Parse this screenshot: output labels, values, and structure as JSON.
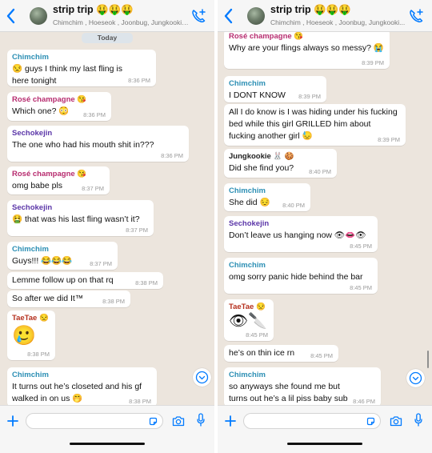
{
  "left": {
    "header": {
      "title": "strip trip 🤑🤑🤑",
      "subtitle": "Chimchim , Hoeseok , Joonbug, Jungkookie..."
    },
    "date_label": "Today",
    "messages": [
      {
        "sender": "Chimchim",
        "text": "😒 guys I think my last fling is here tonight",
        "time": "8:36 PM"
      },
      {
        "sender": "Rosé champagne 😘",
        "text": "Which one? 😳",
        "time": "8:36 PM"
      },
      {
        "sender": "Sechokejin",
        "text": "The one who had his mouth shit in???",
        "time": "8:36 PM"
      },
      {
        "sender": "Rosé champagne 😘",
        "text": "omg babe pls",
        "time": "8:37 PM"
      },
      {
        "sender": "Sechokejin",
        "text": "🤮 that was his last fling wasn’t it?",
        "time": "8:37 PM"
      },
      {
        "sender": "Chimchim",
        "text": "Guys!!! 😂😂😂",
        "time": "8:37 PM"
      },
      {
        "text": "Lemme follow up on that rq",
        "time": "8:38 PM"
      },
      {
        "text": "So after we did It™",
        "time": "8:38 PM"
      },
      {
        "sender": "TaeTae 😒",
        "text": "🥲",
        "time": "8:38 PM"
      },
      {
        "sender": "Chimchim",
        "text": "It turns out he’s closeted and his gf walked in on us 🤭",
        "time": "8:38 PM"
      }
    ]
  },
  "right": {
    "header": {
      "title": "strip trip 🤑🤑🤑",
      "subtitle": "Chimchim , Hoeseok , Joonbug, Jungkooki..."
    },
    "messages": [
      {
        "sender": "Rosé champagne 😘",
        "text": "Why are your flings always so messy? 😭",
        "time": "8:39 PM"
      },
      {
        "sender": "Chimchim",
        "text": "I DONT KNOW",
        "time": "8:39 PM"
      },
      {
        "text": "All I do know is I was hiding under his fucking bed while this girl GRILLED him about fucking another girl 😓",
        "time": "8:39 PM"
      },
      {
        "sender": "Jungkookie 🐰 🍪",
        "text": "Did she find you?",
        "time": "8:40 PM"
      },
      {
        "sender": "Chimchim",
        "text": "She did 😔",
        "time": "8:40 PM"
      },
      {
        "sender": "Sechokejin",
        "text": "Don’t leave us hanging now 👁👄👁",
        "time": "8:45 PM"
      },
      {
        "sender": "Chimchim",
        "text": "omg sorry panic hide behind the bar",
        "time": "8:45 PM"
      },
      {
        "sender": "TaeTae 😒",
        "text": "👁🔪",
        "time": "8:45 PM"
      },
      {
        "text": "he’s on thin ice rn",
        "time": "8:45 PM"
      },
      {
        "sender": "Chimchim",
        "text": "so anyways she found me but turns out he’s a lil piss baby sub right??",
        "time": "8:46 PM"
      }
    ]
  },
  "colors": {
    "chat_background": "#ece5dd",
    "bubble": "#ffffff",
    "accent_blue": "#007aff",
    "sender_chimchim": "#2c8fb4",
    "sender_rose": "#b72c6f",
    "sender_sechokejin": "#5b36a8",
    "sender_taetae": "#b5301e"
  },
  "icons": [
    "back-chevron-icon",
    "avatar",
    "add-participant-call-icon",
    "plus-icon",
    "sticker-icon",
    "camera-icon",
    "microphone-icon",
    "scroll-down-chevron-icon"
  ]
}
